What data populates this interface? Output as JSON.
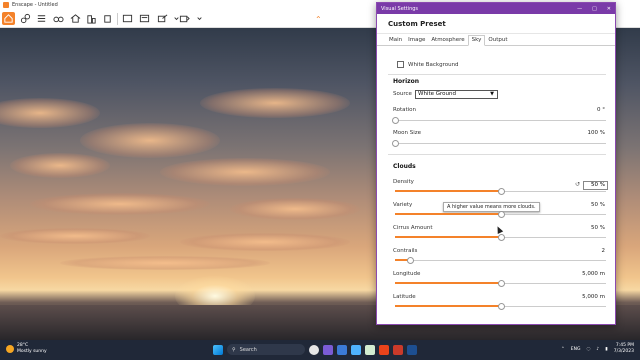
{
  "app": {
    "title": "Enscape - Untitled"
  },
  "vs": {
    "title": "Visual Settings",
    "preset": "Custom Preset",
    "tabs": [
      "Main",
      "Image",
      "Atmosphere",
      "Sky",
      "Output"
    ],
    "active_tab": "Sky",
    "white_background_label": "White Background",
    "white_background_checked": false,
    "horizon": {
      "title": "Horizon",
      "source_label": "Source",
      "source_value": "White Ground",
      "rotation_label": "Rotation",
      "rotation_value": "0 °",
      "rotation_level": 0,
      "moon_label": "Moon Size",
      "moon_value": "100 %",
      "moon_level": 0
    },
    "clouds": {
      "title": "Clouds",
      "density_label": "Density",
      "density_value": "50",
      "density_unit": "%",
      "density_level": 0.5,
      "tooltip": "A higher value means more clouds.",
      "variety_label": "Variety",
      "variety_value": "50 %",
      "variety_level": 0.5,
      "cirrus_label": "Cirrus Amount",
      "cirrus_value": "50 %",
      "cirrus_level": 0.5,
      "contrails_label": "Contrails",
      "contrails_value": "2",
      "contrails_level": 0.07,
      "longitude_label": "Longitude",
      "longitude_value": "5,000  m",
      "longitude_level": 0.5,
      "latitude_label": "Latitude",
      "latitude_value": "5,000  m",
      "latitude_level": 0.5
    },
    "accent": "#f4822a"
  },
  "taskbar": {
    "temp": "28°C",
    "weather": "Mostly sunny",
    "search": "Search",
    "lang": "ENG",
    "time": "7:45 PM",
    "date": "7/3/2023"
  }
}
